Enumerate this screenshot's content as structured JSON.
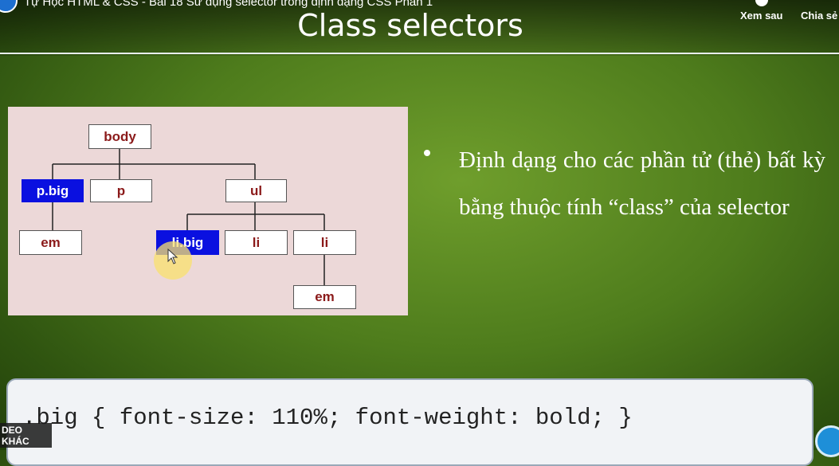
{
  "video": {
    "title": "Tự Học HTML & CSS - Bài 18 Sử dụng selector trong định dạng CSS Phần 1"
  },
  "actions": {
    "watch_later": "Xem sau",
    "share": "Chia sẻ"
  },
  "slide": {
    "title": "Class selectors",
    "bullet": "Định dạng cho các phần tử (thẻ) bất kỳ bằng thuộc tính “class” của selector",
    "code": ".big { font-size: 110%; font-weight: bold; }"
  },
  "tree": {
    "body": "body",
    "p_big": "p.big",
    "p": "p",
    "ul": "ul",
    "em_1": "em",
    "li_big": "li.big",
    "li_1": "li",
    "li_2": "li",
    "em_2": "em",
    "highlight_color": "#0a10e0",
    "label_color": "#8b1a1a"
  },
  "overlay": {
    "more_videos": "DEO KHÁC"
  },
  "colors": {
    "code_background": "#f1f3f6",
    "panel_background": "#ecd8d8"
  }
}
